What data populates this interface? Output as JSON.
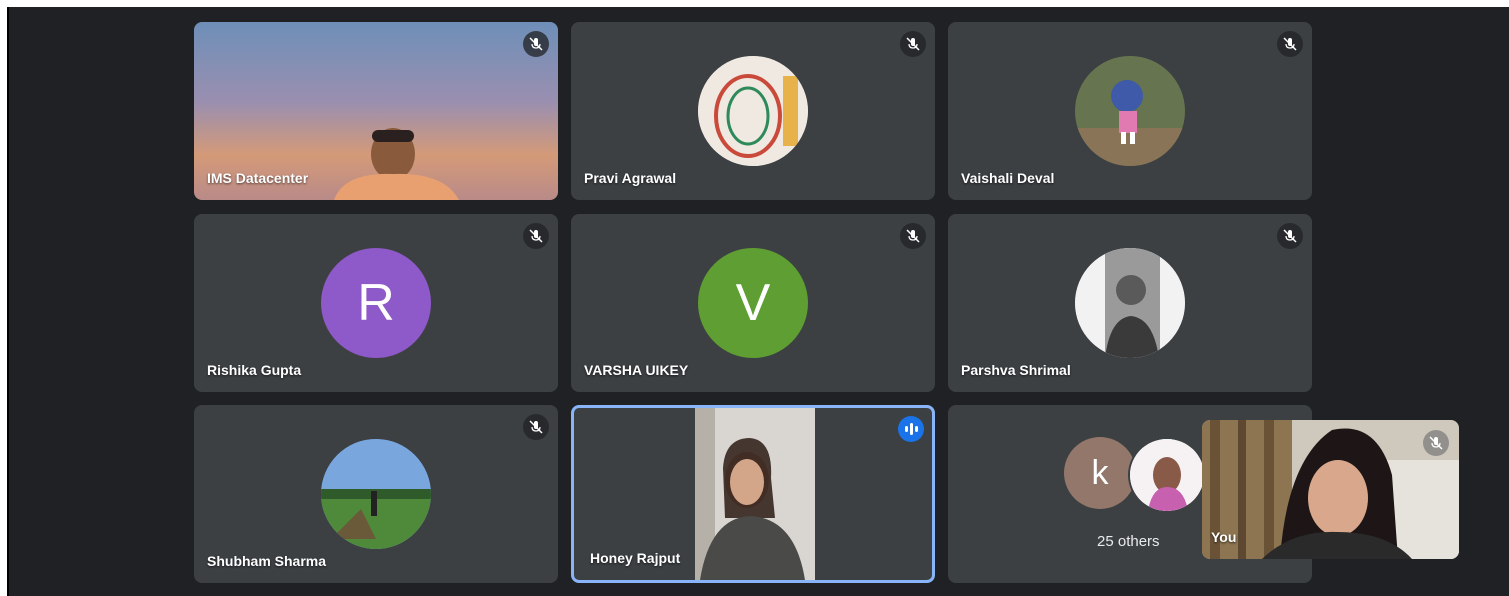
{
  "participants": [
    {
      "name": "IMS Datacenter"
    },
    {
      "name": "Pravi Agrawal"
    },
    {
      "name": "Vaishali Deval"
    },
    {
      "name": "Rishika Gupta",
      "initial": "R"
    },
    {
      "name": "VARSHA UIKEY",
      "initial": "V"
    },
    {
      "name": "Parshva Shrimal"
    },
    {
      "name": "Shubham Sharma"
    },
    {
      "name": "Honey Rajput"
    }
  ],
  "others": {
    "initial": "k",
    "label": "25 others"
  },
  "self_view": {
    "label": "You"
  },
  "colors": {
    "background": "#202124",
    "tile": "#3c4043",
    "active_border": "#8ab4f8",
    "avatar_r": "#8e59c8",
    "avatar_v": "#5f9e32",
    "avatar_k": "#93776b",
    "speaking": "#1a73e8"
  },
  "icons": [
    "mic-off-icon",
    "speaking-indicator-icon"
  ]
}
